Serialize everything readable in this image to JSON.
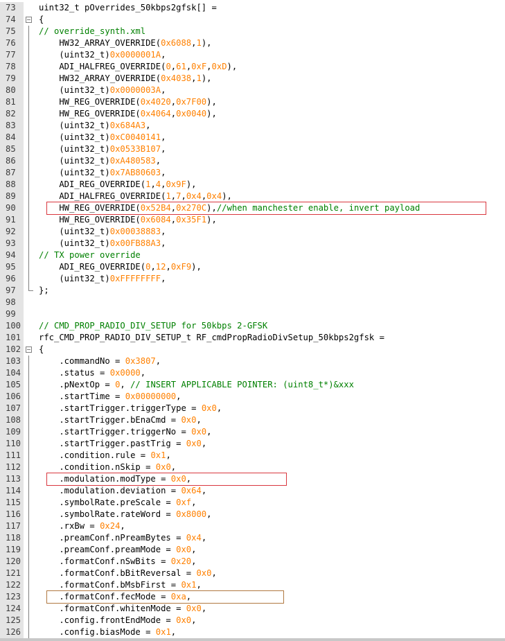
{
  "colors": {
    "gutter_bg": "#e4e4e4",
    "text": "#000000",
    "number": "#ff8000",
    "comment": "#008000",
    "highlight_red": "#d9363e",
    "highlight_brown": "#b07840"
  },
  "lines": [
    {
      "num": "73",
      "fold": "none",
      "tokens": [
        {
          "t": "uint32_t pOverrides_50kbps2gfsk[] =",
          "c": "plain"
        }
      ]
    },
    {
      "num": "74",
      "fold": "open",
      "tokens": [
        {
          "t": "{",
          "c": "plain"
        }
      ]
    },
    {
      "num": "75",
      "fold": "mid",
      "tokens": [
        {
          "t": "// override_synth.xml",
          "c": "comment"
        }
      ]
    },
    {
      "num": "76",
      "fold": "mid",
      "tokens": [
        {
          "t": "    HW32_ARRAY_OVERRIDE(",
          "c": "plain"
        },
        {
          "t": "0x6088",
          "c": "num"
        },
        {
          "t": ",",
          "c": "plain"
        },
        {
          "t": "1",
          "c": "num"
        },
        {
          "t": "),",
          "c": "plain"
        }
      ]
    },
    {
      "num": "77",
      "fold": "mid",
      "tokens": [
        {
          "t": "    (uint32_t)",
          "c": "plain"
        },
        {
          "t": "0x0000001A",
          "c": "num"
        },
        {
          "t": ",",
          "c": "plain"
        }
      ]
    },
    {
      "num": "78",
      "fold": "mid",
      "tokens": [
        {
          "t": "    ADI_HALFREG_OVERRIDE(",
          "c": "plain"
        },
        {
          "t": "0",
          "c": "num"
        },
        {
          "t": ",",
          "c": "plain"
        },
        {
          "t": "61",
          "c": "num"
        },
        {
          "t": ",",
          "c": "plain"
        },
        {
          "t": "0xF",
          "c": "num"
        },
        {
          "t": ",",
          "c": "plain"
        },
        {
          "t": "0xD",
          "c": "num"
        },
        {
          "t": "),",
          "c": "plain"
        }
      ]
    },
    {
      "num": "79",
      "fold": "mid",
      "tokens": [
        {
          "t": "    HW32_ARRAY_OVERRIDE(",
          "c": "plain"
        },
        {
          "t": "0x4038",
          "c": "num"
        },
        {
          "t": ",",
          "c": "plain"
        },
        {
          "t": "1",
          "c": "num"
        },
        {
          "t": "),",
          "c": "plain"
        }
      ]
    },
    {
      "num": "80",
      "fold": "mid",
      "tokens": [
        {
          "t": "    (uint32_t)",
          "c": "plain"
        },
        {
          "t": "0x0000003A",
          "c": "num"
        },
        {
          "t": ",",
          "c": "plain"
        }
      ]
    },
    {
      "num": "81",
      "fold": "mid",
      "tokens": [
        {
          "t": "    HW_REG_OVERRIDE(",
          "c": "plain"
        },
        {
          "t": "0x4020",
          "c": "num"
        },
        {
          "t": ",",
          "c": "plain"
        },
        {
          "t": "0x7F00",
          "c": "num"
        },
        {
          "t": "),",
          "c": "plain"
        }
      ]
    },
    {
      "num": "82",
      "fold": "mid",
      "tokens": [
        {
          "t": "    HW_REG_OVERRIDE(",
          "c": "plain"
        },
        {
          "t": "0x4064",
          "c": "num"
        },
        {
          "t": ",",
          "c": "plain"
        },
        {
          "t": "0x0040",
          "c": "num"
        },
        {
          "t": "),",
          "c": "plain"
        }
      ]
    },
    {
      "num": "83",
      "fold": "mid",
      "tokens": [
        {
          "t": "    (uint32_t)",
          "c": "plain"
        },
        {
          "t": "0x684A3",
          "c": "num"
        },
        {
          "t": ",",
          "c": "plain"
        }
      ]
    },
    {
      "num": "84",
      "fold": "mid",
      "tokens": [
        {
          "t": "    (uint32_t)",
          "c": "plain"
        },
        {
          "t": "0xC0040141",
          "c": "num"
        },
        {
          "t": ",",
          "c": "plain"
        }
      ]
    },
    {
      "num": "85",
      "fold": "mid",
      "tokens": [
        {
          "t": "    (uint32_t)",
          "c": "plain"
        },
        {
          "t": "0x0533B107",
          "c": "num"
        },
        {
          "t": ",",
          "c": "plain"
        }
      ]
    },
    {
      "num": "86",
      "fold": "mid",
      "tokens": [
        {
          "t": "    (uint32_t)",
          "c": "plain"
        },
        {
          "t": "0xA480583",
          "c": "num"
        },
        {
          "t": ",",
          "c": "plain"
        }
      ]
    },
    {
      "num": "87",
      "fold": "mid",
      "tokens": [
        {
          "t": "    (uint32_t)",
          "c": "plain"
        },
        {
          "t": "0x7AB80603",
          "c": "num"
        },
        {
          "t": ",",
          "c": "plain"
        }
      ]
    },
    {
      "num": "88",
      "fold": "mid",
      "tokens": [
        {
          "t": "    ADI_REG_OVERRIDE(",
          "c": "plain"
        },
        {
          "t": "1",
          "c": "num"
        },
        {
          "t": ",",
          "c": "plain"
        },
        {
          "t": "4",
          "c": "num"
        },
        {
          "t": ",",
          "c": "plain"
        },
        {
          "t": "0x9F",
          "c": "num"
        },
        {
          "t": "),",
          "c": "plain"
        }
      ]
    },
    {
      "num": "89",
      "fold": "mid",
      "tokens": [
        {
          "t": "    ADI_HALFREG_OVERRIDE(",
          "c": "plain"
        },
        {
          "t": "1",
          "c": "num"
        },
        {
          "t": ",",
          "c": "plain"
        },
        {
          "t": "7",
          "c": "num"
        },
        {
          "t": ",",
          "c": "plain"
        },
        {
          "t": "0x4",
          "c": "num"
        },
        {
          "t": ",",
          "c": "plain"
        },
        {
          "t": "0x4",
          "c": "num"
        },
        {
          "t": "),",
          "c": "plain"
        }
      ]
    },
    {
      "num": "90",
      "fold": "mid",
      "tokens": [
        {
          "t": "    HW_REG_OVERRIDE(",
          "c": "plain"
        },
        {
          "t": "0x52B4",
          "c": "num"
        },
        {
          "t": ",",
          "c": "plain"
        },
        {
          "t": "0x270C",
          "c": "num"
        },
        {
          "t": "),",
          "c": "plain"
        },
        {
          "t": "//when manchester enable, invert payload",
          "c": "comment"
        }
      ]
    },
    {
      "num": "91",
      "fold": "mid",
      "tokens": [
        {
          "t": "    HW_REG_OVERRIDE(",
          "c": "plain"
        },
        {
          "t": "0x6084",
          "c": "num"
        },
        {
          "t": ",",
          "c": "plain"
        },
        {
          "t": "0x35F1",
          "c": "num"
        },
        {
          "t": "),",
          "c": "plain"
        }
      ]
    },
    {
      "num": "92",
      "fold": "mid",
      "tokens": [
        {
          "t": "    (uint32_t)",
          "c": "plain"
        },
        {
          "t": "0x00038883",
          "c": "num"
        },
        {
          "t": ",",
          "c": "plain"
        }
      ]
    },
    {
      "num": "93",
      "fold": "mid",
      "tokens": [
        {
          "t": "    (uint32_t)",
          "c": "plain"
        },
        {
          "t": "0x00FB88A3",
          "c": "num"
        },
        {
          "t": ",",
          "c": "plain"
        }
      ]
    },
    {
      "num": "94",
      "fold": "mid",
      "tokens": [
        {
          "t": "// TX power override",
          "c": "comment"
        }
      ]
    },
    {
      "num": "95",
      "fold": "mid",
      "tokens": [
        {
          "t": "    ADI_REG_OVERRIDE(",
          "c": "plain"
        },
        {
          "t": "0",
          "c": "num"
        },
        {
          "t": ",",
          "c": "plain"
        },
        {
          "t": "12",
          "c": "num"
        },
        {
          "t": ",",
          "c": "plain"
        },
        {
          "t": "0xF9",
          "c": "num"
        },
        {
          "t": "),",
          "c": "plain"
        }
      ]
    },
    {
      "num": "96",
      "fold": "mid",
      "tokens": [
        {
          "t": "    (uint32_t)",
          "c": "plain"
        },
        {
          "t": "0xFFFFFFFF",
          "c": "num"
        },
        {
          "t": ",",
          "c": "plain"
        }
      ]
    },
    {
      "num": "97",
      "fold": "end",
      "tokens": [
        {
          "t": "};",
          "c": "plain"
        }
      ]
    },
    {
      "num": "98",
      "fold": "none",
      "tokens": []
    },
    {
      "num": "99",
      "fold": "none",
      "tokens": []
    },
    {
      "num": "100",
      "fold": "none",
      "tokens": [
        {
          "t": "// CMD_PROP_RADIO_DIV_SETUP for 50kbps 2-GFSK",
          "c": "comment"
        }
      ]
    },
    {
      "num": "101",
      "fold": "none",
      "tokens": [
        {
          "t": "rfc_CMD_PROP_RADIO_DIV_SETUP_t RF_cmdPropRadioDivSetup_50kbps2gfsk =",
          "c": "plain"
        }
      ]
    },
    {
      "num": "102",
      "fold": "open",
      "tokens": [
        {
          "t": "{",
          "c": "plain"
        }
      ]
    },
    {
      "num": "103",
      "fold": "mid",
      "tokens": [
        {
          "t": "    .commandNo = ",
          "c": "plain"
        },
        {
          "t": "0x3807",
          "c": "num"
        },
        {
          "t": ",",
          "c": "plain"
        }
      ]
    },
    {
      "num": "104",
      "fold": "mid",
      "tokens": [
        {
          "t": "    .status = ",
          "c": "plain"
        },
        {
          "t": "0x0000",
          "c": "num"
        },
        {
          "t": ",",
          "c": "plain"
        }
      ]
    },
    {
      "num": "105",
      "fold": "mid",
      "tokens": [
        {
          "t": "    .pNextOp = ",
          "c": "plain"
        },
        {
          "t": "0",
          "c": "num"
        },
        {
          "t": ", ",
          "c": "plain"
        },
        {
          "t": "// INSERT APPLICABLE POINTER: (uint8_t*)&xxx",
          "c": "comment"
        }
      ]
    },
    {
      "num": "106",
      "fold": "mid",
      "tokens": [
        {
          "t": "    .startTime = ",
          "c": "plain"
        },
        {
          "t": "0x00000000",
          "c": "num"
        },
        {
          "t": ",",
          "c": "plain"
        }
      ]
    },
    {
      "num": "107",
      "fold": "mid",
      "tokens": [
        {
          "t": "    .startTrigger.triggerType = ",
          "c": "plain"
        },
        {
          "t": "0x0",
          "c": "num"
        },
        {
          "t": ",",
          "c": "plain"
        }
      ]
    },
    {
      "num": "108",
      "fold": "mid",
      "tokens": [
        {
          "t": "    .startTrigger.bEnaCmd = ",
          "c": "plain"
        },
        {
          "t": "0x0",
          "c": "num"
        },
        {
          "t": ",",
          "c": "plain"
        }
      ]
    },
    {
      "num": "109",
      "fold": "mid",
      "tokens": [
        {
          "t": "    .startTrigger.triggerNo = ",
          "c": "plain"
        },
        {
          "t": "0x0",
          "c": "num"
        },
        {
          "t": ",",
          "c": "plain"
        }
      ]
    },
    {
      "num": "110",
      "fold": "mid",
      "tokens": [
        {
          "t": "    .startTrigger.pastTrig = ",
          "c": "plain"
        },
        {
          "t": "0x0",
          "c": "num"
        },
        {
          "t": ",",
          "c": "plain"
        }
      ]
    },
    {
      "num": "111",
      "fold": "mid",
      "tokens": [
        {
          "t": "    .condition.rule = ",
          "c": "plain"
        },
        {
          "t": "0x1",
          "c": "num"
        },
        {
          "t": ",",
          "c": "plain"
        }
      ]
    },
    {
      "num": "112",
      "fold": "mid",
      "tokens": [
        {
          "t": "    .condition.nSkip = ",
          "c": "plain"
        },
        {
          "t": "0x0",
          "c": "num"
        },
        {
          "t": ",",
          "c": "plain"
        }
      ]
    },
    {
      "num": "113",
      "fold": "mid",
      "tokens": [
        {
          "t": "    .modulation.modType = ",
          "c": "plain"
        },
        {
          "t": "0x0",
          "c": "num"
        },
        {
          "t": ",",
          "c": "plain"
        }
      ]
    },
    {
      "num": "114",
      "fold": "mid",
      "tokens": [
        {
          "t": "    .modulation.deviation = ",
          "c": "plain"
        },
        {
          "t": "0x64",
          "c": "num"
        },
        {
          "t": ",",
          "c": "plain"
        }
      ]
    },
    {
      "num": "115",
      "fold": "mid",
      "tokens": [
        {
          "t": "    .symbolRate.preScale = ",
          "c": "plain"
        },
        {
          "t": "0xf",
          "c": "num"
        },
        {
          "t": ",",
          "c": "plain"
        }
      ]
    },
    {
      "num": "116",
      "fold": "mid",
      "tokens": [
        {
          "t": "    .symbolRate.rateWord = ",
          "c": "plain"
        },
        {
          "t": "0x8000",
          "c": "num"
        },
        {
          "t": ",",
          "c": "plain"
        }
      ]
    },
    {
      "num": "117",
      "fold": "mid",
      "tokens": [
        {
          "t": "    .rxBw = ",
          "c": "plain"
        },
        {
          "t": "0x24",
          "c": "num"
        },
        {
          "t": ",",
          "c": "plain"
        }
      ]
    },
    {
      "num": "118",
      "fold": "mid",
      "tokens": [
        {
          "t": "    .preamConf.nPreamBytes = ",
          "c": "plain"
        },
        {
          "t": "0x4",
          "c": "num"
        },
        {
          "t": ",",
          "c": "plain"
        }
      ]
    },
    {
      "num": "119",
      "fold": "mid",
      "tokens": [
        {
          "t": "    .preamConf.preamMode = ",
          "c": "plain"
        },
        {
          "t": "0x0",
          "c": "num"
        },
        {
          "t": ",",
          "c": "plain"
        }
      ]
    },
    {
      "num": "120",
      "fold": "mid",
      "tokens": [
        {
          "t": "    .formatConf.nSwBits = ",
          "c": "plain"
        },
        {
          "t": "0x20",
          "c": "num"
        },
        {
          "t": ",",
          "c": "plain"
        }
      ]
    },
    {
      "num": "121",
      "fold": "mid",
      "tokens": [
        {
          "t": "    .formatConf.bBitReversal = ",
          "c": "plain"
        },
        {
          "t": "0x0",
          "c": "num"
        },
        {
          "t": ",",
          "c": "plain"
        }
      ]
    },
    {
      "num": "122",
      "fold": "mid",
      "tokens": [
        {
          "t": "    .formatConf.bMsbFirst = ",
          "c": "plain"
        },
        {
          "t": "0x1",
          "c": "num"
        },
        {
          "t": ",",
          "c": "plain"
        }
      ]
    },
    {
      "num": "123",
      "fold": "mid",
      "tokens": [
        {
          "t": "    .formatConf.fecMode = ",
          "c": "plain"
        },
        {
          "t": "0xa",
          "c": "num"
        },
        {
          "t": ",",
          "c": "plain"
        }
      ]
    },
    {
      "num": "124",
      "fold": "mid",
      "tokens": [
        {
          "t": "    .formatConf.whitenMode = ",
          "c": "plain"
        },
        {
          "t": "0x0",
          "c": "num"
        },
        {
          "t": ",",
          "c": "plain"
        }
      ]
    },
    {
      "num": "125",
      "fold": "mid",
      "tokens": [
        {
          "t": "    .config.frontEndMode = ",
          "c": "plain"
        },
        {
          "t": "0x0",
          "c": "num"
        },
        {
          "t": ",",
          "c": "plain"
        }
      ]
    },
    {
      "num": "126",
      "fold": "mid",
      "tokens": [
        {
          "t": "    .config.biasMode = ",
          "c": "plain"
        },
        {
          "t": "0x1",
          "c": "num"
        },
        {
          "t": ",",
          "c": "plain"
        }
      ]
    }
  ],
  "highlights": [
    {
      "line": "90",
      "style": "red"
    },
    {
      "line": "113",
      "style": "red"
    },
    {
      "line": "123",
      "style": "brown"
    }
  ]
}
